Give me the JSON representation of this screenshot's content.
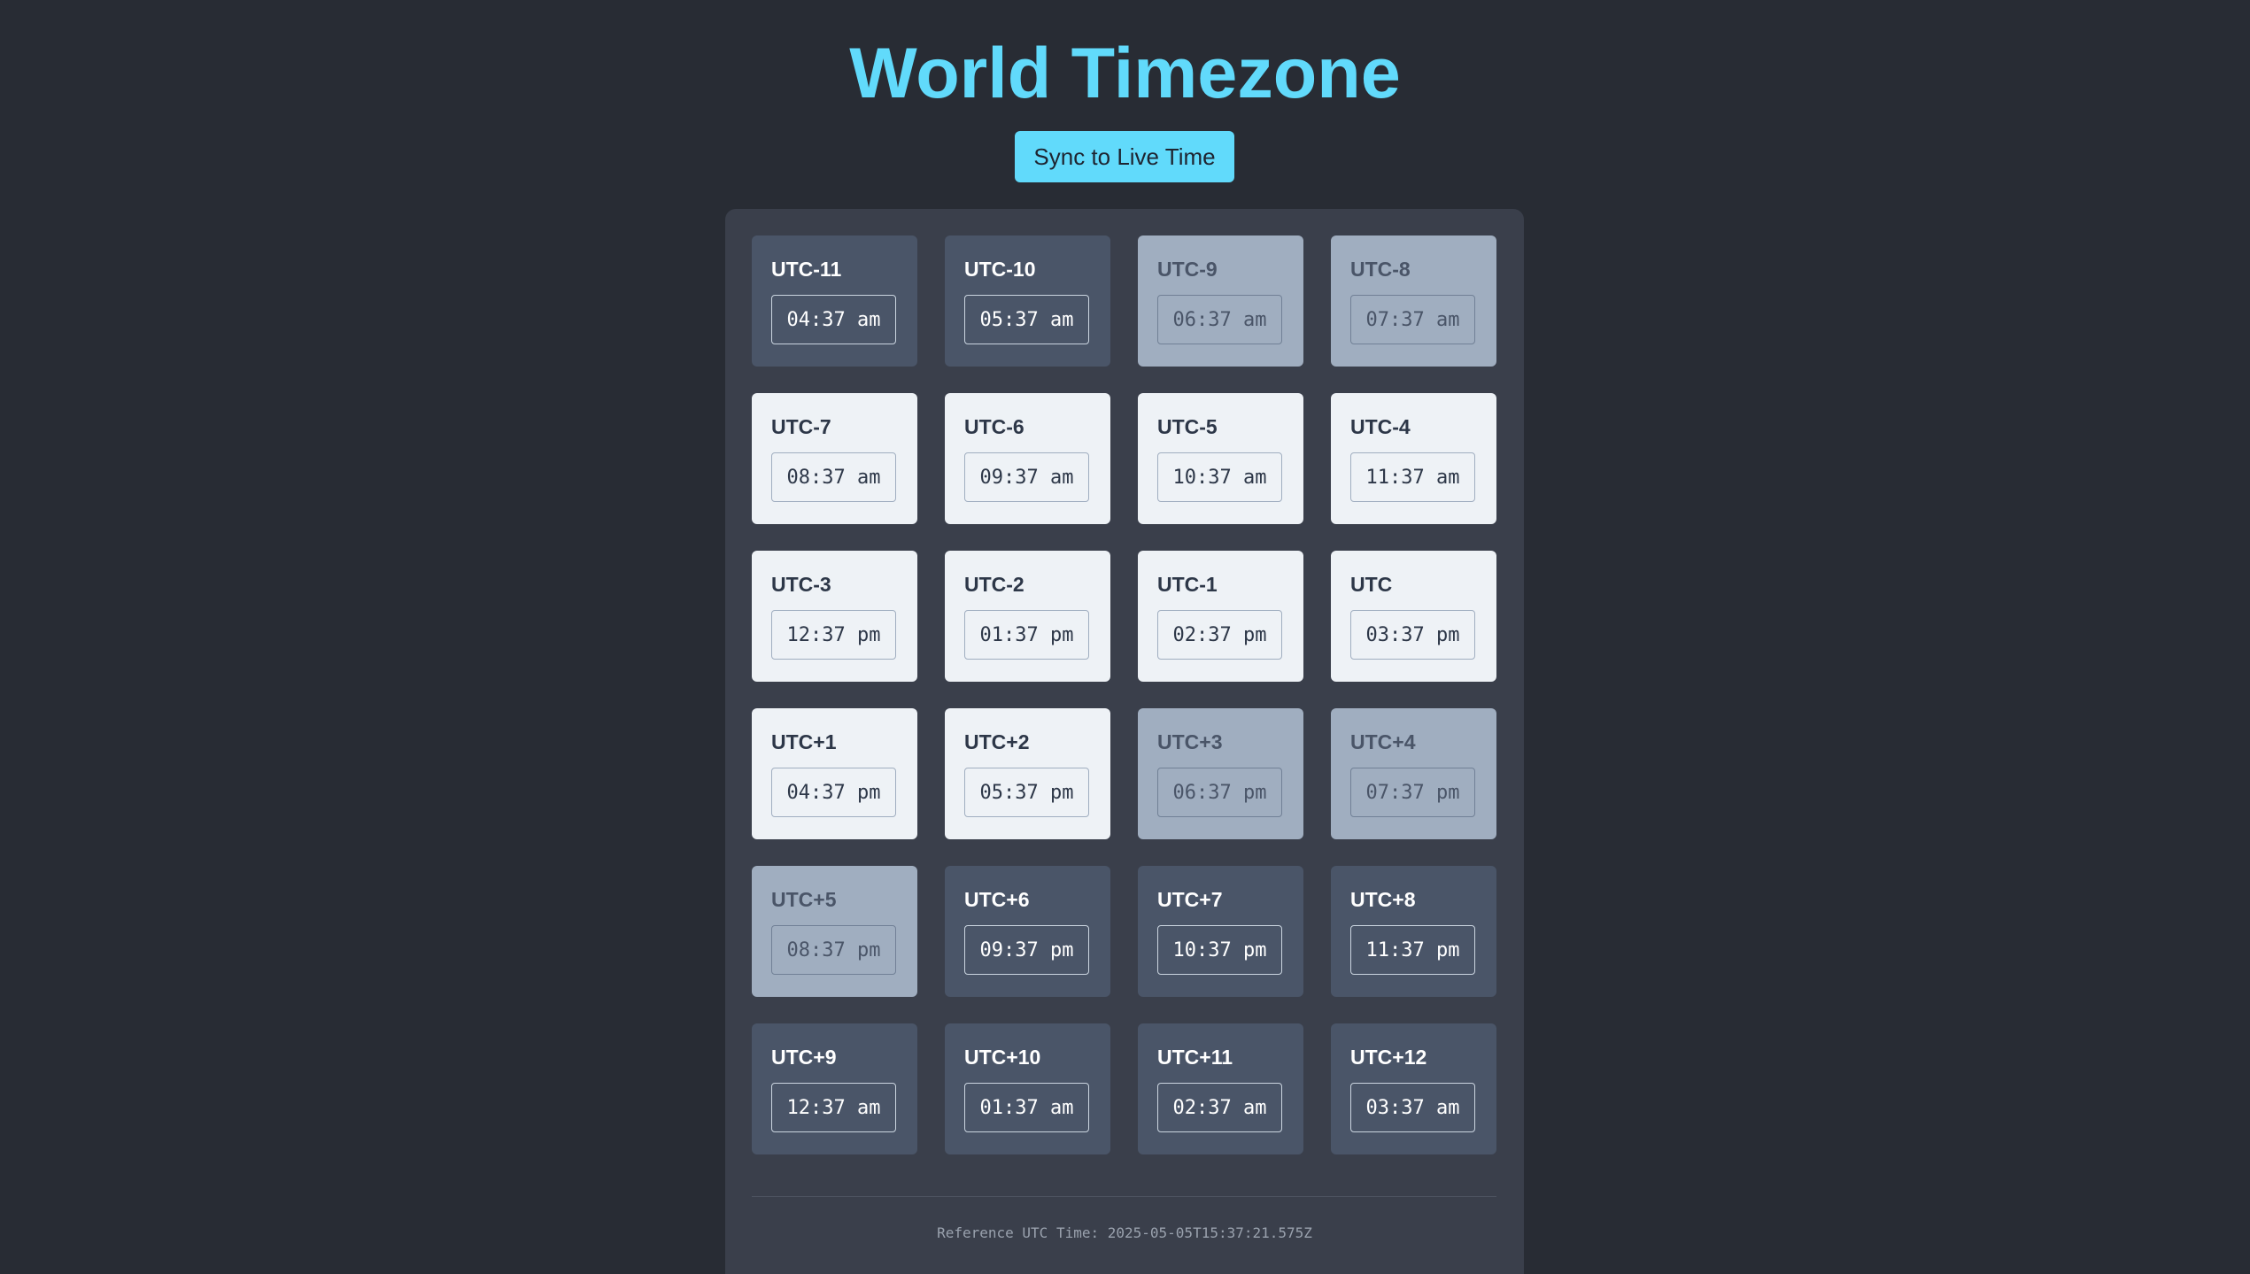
{
  "header": {
    "title": "World Timezone",
    "sync_label": "Sync to Live Time"
  },
  "colors": {
    "background": "#282c34",
    "accent": "#61dafb",
    "panel": "#3a3f4b",
    "night_card": "#4a5568",
    "twilight_card": "#a0aec0",
    "day_card": "#eef2f6"
  },
  "zones": [
    {
      "label": "UTC-11",
      "time": "04:37 am",
      "phase": "night"
    },
    {
      "label": "UTC-10",
      "time": "05:37 am",
      "phase": "night"
    },
    {
      "label": "UTC-9",
      "time": "06:37 am",
      "phase": "twilight"
    },
    {
      "label": "UTC-8",
      "time": "07:37 am",
      "phase": "twilight"
    },
    {
      "label": "UTC-7",
      "time": "08:37 am",
      "phase": "day"
    },
    {
      "label": "UTC-6",
      "time": "09:37 am",
      "phase": "day"
    },
    {
      "label": "UTC-5",
      "time": "10:37 am",
      "phase": "day"
    },
    {
      "label": "UTC-4",
      "time": "11:37 am",
      "phase": "day"
    },
    {
      "label": "UTC-3",
      "time": "12:37 pm",
      "phase": "day"
    },
    {
      "label": "UTC-2",
      "time": "01:37 pm",
      "phase": "day"
    },
    {
      "label": "UTC-1",
      "time": "02:37 pm",
      "phase": "day"
    },
    {
      "label": "UTC",
      "time": "03:37 pm",
      "phase": "day"
    },
    {
      "label": "UTC+1",
      "time": "04:37 pm",
      "phase": "day"
    },
    {
      "label": "UTC+2",
      "time": "05:37 pm",
      "phase": "day"
    },
    {
      "label": "UTC+3",
      "time": "06:37 pm",
      "phase": "twilight"
    },
    {
      "label": "UTC+4",
      "time": "07:37 pm",
      "phase": "twilight"
    },
    {
      "label": "UTC+5",
      "time": "08:37 pm",
      "phase": "twilight"
    },
    {
      "label": "UTC+6",
      "time": "09:37 pm",
      "phase": "night"
    },
    {
      "label": "UTC+7",
      "time": "10:37 pm",
      "phase": "night"
    },
    {
      "label": "UTC+8",
      "time": "11:37 pm",
      "phase": "night"
    },
    {
      "label": "UTC+9",
      "time": "12:37 am",
      "phase": "night"
    },
    {
      "label": "UTC+10",
      "time": "01:37 am",
      "phase": "night"
    },
    {
      "label": "UTC+11",
      "time": "02:37 am",
      "phase": "night"
    },
    {
      "label": "UTC+12",
      "time": "03:37 am",
      "phase": "night"
    }
  ],
  "footer": {
    "reference": "Reference UTC Time: 2025-05-05T15:37:21.575Z"
  }
}
